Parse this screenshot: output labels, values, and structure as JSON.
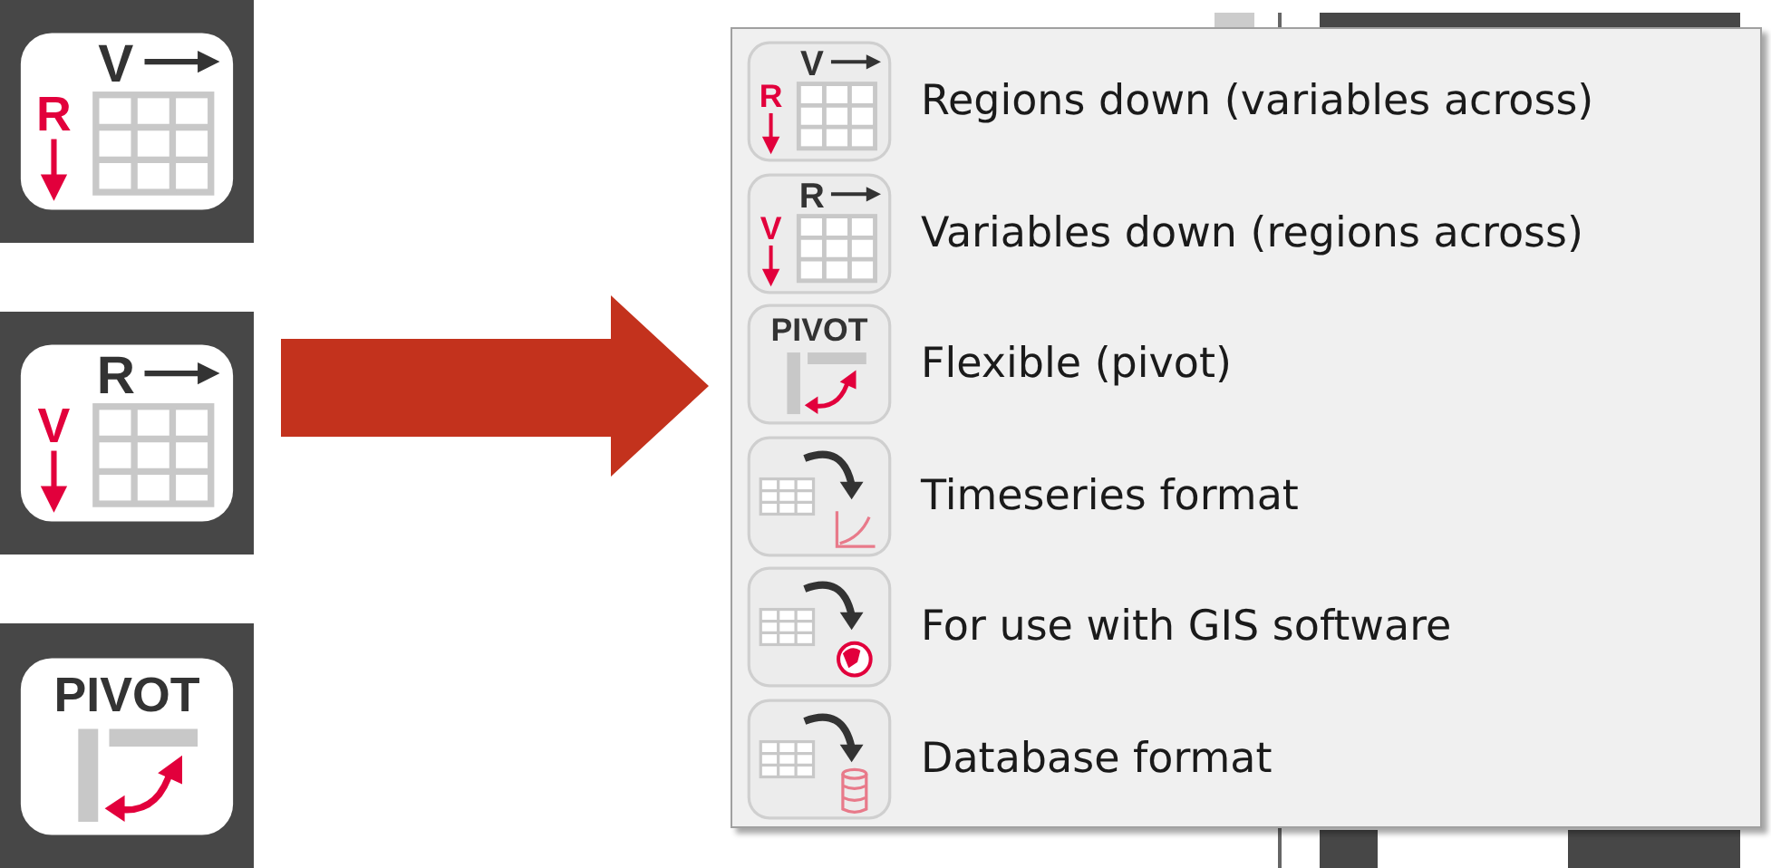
{
  "large_buttons": [
    {
      "kind": "regions-down",
      "top_letter": "V",
      "side_letter": "R"
    },
    {
      "kind": "variables-down",
      "top_letter": "R",
      "side_letter": "V"
    },
    {
      "kind": "pivot",
      "label": "PIVOT"
    }
  ],
  "menu": {
    "items": [
      {
        "kind": "regions-down",
        "top_letter": "V",
        "side_letter": "R",
        "label": "Regions down (variables across)"
      },
      {
        "kind": "variables-down",
        "top_letter": "R",
        "side_letter": "V",
        "label": "Variables down (regions across)"
      },
      {
        "kind": "pivot",
        "icon_label": "PIVOT",
        "label": "Flexible (pivot)"
      },
      {
        "kind": "timeseries",
        "label": "Timeseries format"
      },
      {
        "kind": "gis",
        "label": "For use with GIS software"
      },
      {
        "kind": "database",
        "label": "Database format"
      }
    ]
  }
}
